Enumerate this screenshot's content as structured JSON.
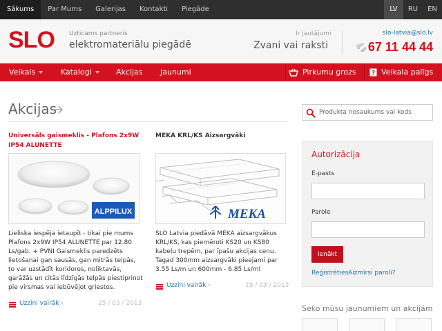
{
  "topnav": {
    "items": [
      "Sākums",
      "Par Mums",
      "Galerijas",
      "Kontakti",
      "Piegāde"
    ],
    "active": 0
  },
  "languages": {
    "items": [
      "LV",
      "RU",
      "EN"
    ],
    "active": 0
  },
  "header": {
    "logo": "SLO",
    "tagline_small": "Uzticams partneris",
    "tagline_large": "elektromateriālu piegādē",
    "question": "Ir jautājumi",
    "call_text": "Zvani vai raksti",
    "email": "slo-latvia@slo.lv",
    "phone": "67 11 44 44"
  },
  "mainnav": {
    "items": [
      "Veikals",
      "Katalogi",
      "Akcijas",
      "Jaunumi"
    ],
    "cart": "Pirkumu grozs",
    "help": "Veikala palīgs"
  },
  "section": {
    "title": "Akcijas"
  },
  "articles": [
    {
      "title": "Universāls gaismeklis - Plafons 2x9W IP54 ALUNETTE",
      "brand": "ALPPILUX",
      "description": "Lieliska iespēja ietaupīt - tikai pie mums Plafons 2x9W IP54 ALUNETTE par 12.80 Ls/gab. + PVNI Gaismeklis paredzēts lietošanai gan sausās, gan mitrās telpās, to var uzstādīt koridoros, noliktavās, garāžās un citās līdzīgās telpās piestiprinot pie virsmas vai iebūvējot griestos.",
      "more": "Uzzini vairāk",
      "date": "25 / 03 / 2013"
    },
    {
      "title": "MEKA KRL/KS Aizsargvāki",
      "brand": "MEKA",
      "description": "SLO Latvia piedāvā MEKA aizsargvākus KRL/KS, kas piemēroti KS20 un KS80 kabeļu trepēm, par īpašu akcijas cenu. Tagad 300mm aizsargvāki pieejami par 3.55 Ls/m un 600mm - 6.85 Ls/ml",
      "more": "Uzzini vairāk",
      "date": "19 / 03 / 2013"
    }
  ],
  "search": {
    "placeholder": "Produkta nosaukums vai kods"
  },
  "auth": {
    "title": "Autorizācija",
    "email_label": "E-pasts",
    "password_label": "Parole",
    "login_button": "Ienākt",
    "register": "Reģistrēties",
    "forgot": "Aizmirsi paroli?"
  },
  "follow": "Seko mūsu jaunumiem un akcijām",
  "colors": {
    "brand": "#d4121f",
    "topbar": "#2f2f2f",
    "link": "#1f6fa8"
  }
}
